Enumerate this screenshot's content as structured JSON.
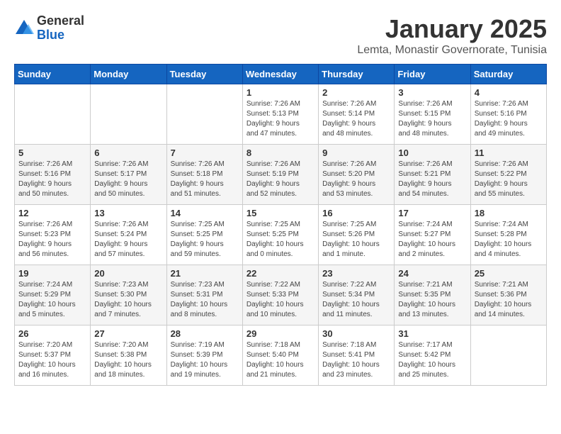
{
  "header": {
    "logo_general": "General",
    "logo_blue": "Blue",
    "title": "January 2025",
    "location": "Lemta, Monastir Governorate, Tunisia"
  },
  "weekdays": [
    "Sunday",
    "Monday",
    "Tuesday",
    "Wednesday",
    "Thursday",
    "Friday",
    "Saturday"
  ],
  "weeks": [
    [
      {
        "day": "",
        "detail": ""
      },
      {
        "day": "",
        "detail": ""
      },
      {
        "day": "",
        "detail": ""
      },
      {
        "day": "1",
        "detail": "Sunrise: 7:26 AM\nSunset: 5:13 PM\nDaylight: 9 hours\nand 47 minutes."
      },
      {
        "day": "2",
        "detail": "Sunrise: 7:26 AM\nSunset: 5:14 PM\nDaylight: 9 hours\nand 48 minutes."
      },
      {
        "day": "3",
        "detail": "Sunrise: 7:26 AM\nSunset: 5:15 PM\nDaylight: 9 hours\nand 48 minutes."
      },
      {
        "day": "4",
        "detail": "Sunrise: 7:26 AM\nSunset: 5:16 PM\nDaylight: 9 hours\nand 49 minutes."
      }
    ],
    [
      {
        "day": "5",
        "detail": "Sunrise: 7:26 AM\nSunset: 5:16 PM\nDaylight: 9 hours\nand 50 minutes."
      },
      {
        "day": "6",
        "detail": "Sunrise: 7:26 AM\nSunset: 5:17 PM\nDaylight: 9 hours\nand 50 minutes."
      },
      {
        "day": "7",
        "detail": "Sunrise: 7:26 AM\nSunset: 5:18 PM\nDaylight: 9 hours\nand 51 minutes."
      },
      {
        "day": "8",
        "detail": "Sunrise: 7:26 AM\nSunset: 5:19 PM\nDaylight: 9 hours\nand 52 minutes."
      },
      {
        "day": "9",
        "detail": "Sunrise: 7:26 AM\nSunset: 5:20 PM\nDaylight: 9 hours\nand 53 minutes."
      },
      {
        "day": "10",
        "detail": "Sunrise: 7:26 AM\nSunset: 5:21 PM\nDaylight: 9 hours\nand 54 minutes."
      },
      {
        "day": "11",
        "detail": "Sunrise: 7:26 AM\nSunset: 5:22 PM\nDaylight: 9 hours\nand 55 minutes."
      }
    ],
    [
      {
        "day": "12",
        "detail": "Sunrise: 7:26 AM\nSunset: 5:23 PM\nDaylight: 9 hours\nand 56 minutes."
      },
      {
        "day": "13",
        "detail": "Sunrise: 7:26 AM\nSunset: 5:24 PM\nDaylight: 9 hours\nand 57 minutes."
      },
      {
        "day": "14",
        "detail": "Sunrise: 7:25 AM\nSunset: 5:25 PM\nDaylight: 9 hours\nand 59 minutes."
      },
      {
        "day": "15",
        "detail": "Sunrise: 7:25 AM\nSunset: 5:25 PM\nDaylight: 10 hours\nand 0 minutes."
      },
      {
        "day": "16",
        "detail": "Sunrise: 7:25 AM\nSunset: 5:26 PM\nDaylight: 10 hours\nand 1 minute."
      },
      {
        "day": "17",
        "detail": "Sunrise: 7:24 AM\nSunset: 5:27 PM\nDaylight: 10 hours\nand 2 minutes."
      },
      {
        "day": "18",
        "detail": "Sunrise: 7:24 AM\nSunset: 5:28 PM\nDaylight: 10 hours\nand 4 minutes."
      }
    ],
    [
      {
        "day": "19",
        "detail": "Sunrise: 7:24 AM\nSunset: 5:29 PM\nDaylight: 10 hours\nand 5 minutes."
      },
      {
        "day": "20",
        "detail": "Sunrise: 7:23 AM\nSunset: 5:30 PM\nDaylight: 10 hours\nand 7 minutes."
      },
      {
        "day": "21",
        "detail": "Sunrise: 7:23 AM\nSunset: 5:31 PM\nDaylight: 10 hours\nand 8 minutes."
      },
      {
        "day": "22",
        "detail": "Sunrise: 7:22 AM\nSunset: 5:33 PM\nDaylight: 10 hours\nand 10 minutes."
      },
      {
        "day": "23",
        "detail": "Sunrise: 7:22 AM\nSunset: 5:34 PM\nDaylight: 10 hours\nand 11 minutes."
      },
      {
        "day": "24",
        "detail": "Sunrise: 7:21 AM\nSunset: 5:35 PM\nDaylight: 10 hours\nand 13 minutes."
      },
      {
        "day": "25",
        "detail": "Sunrise: 7:21 AM\nSunset: 5:36 PM\nDaylight: 10 hours\nand 14 minutes."
      }
    ],
    [
      {
        "day": "26",
        "detail": "Sunrise: 7:20 AM\nSunset: 5:37 PM\nDaylight: 10 hours\nand 16 minutes."
      },
      {
        "day": "27",
        "detail": "Sunrise: 7:20 AM\nSunset: 5:38 PM\nDaylight: 10 hours\nand 18 minutes."
      },
      {
        "day": "28",
        "detail": "Sunrise: 7:19 AM\nSunset: 5:39 PM\nDaylight: 10 hours\nand 19 minutes."
      },
      {
        "day": "29",
        "detail": "Sunrise: 7:18 AM\nSunset: 5:40 PM\nDaylight: 10 hours\nand 21 minutes."
      },
      {
        "day": "30",
        "detail": "Sunrise: 7:18 AM\nSunset: 5:41 PM\nDaylight: 10 hours\nand 23 minutes."
      },
      {
        "day": "31",
        "detail": "Sunrise: 7:17 AM\nSunset: 5:42 PM\nDaylight: 10 hours\nand 25 minutes."
      },
      {
        "day": "",
        "detail": ""
      }
    ]
  ]
}
